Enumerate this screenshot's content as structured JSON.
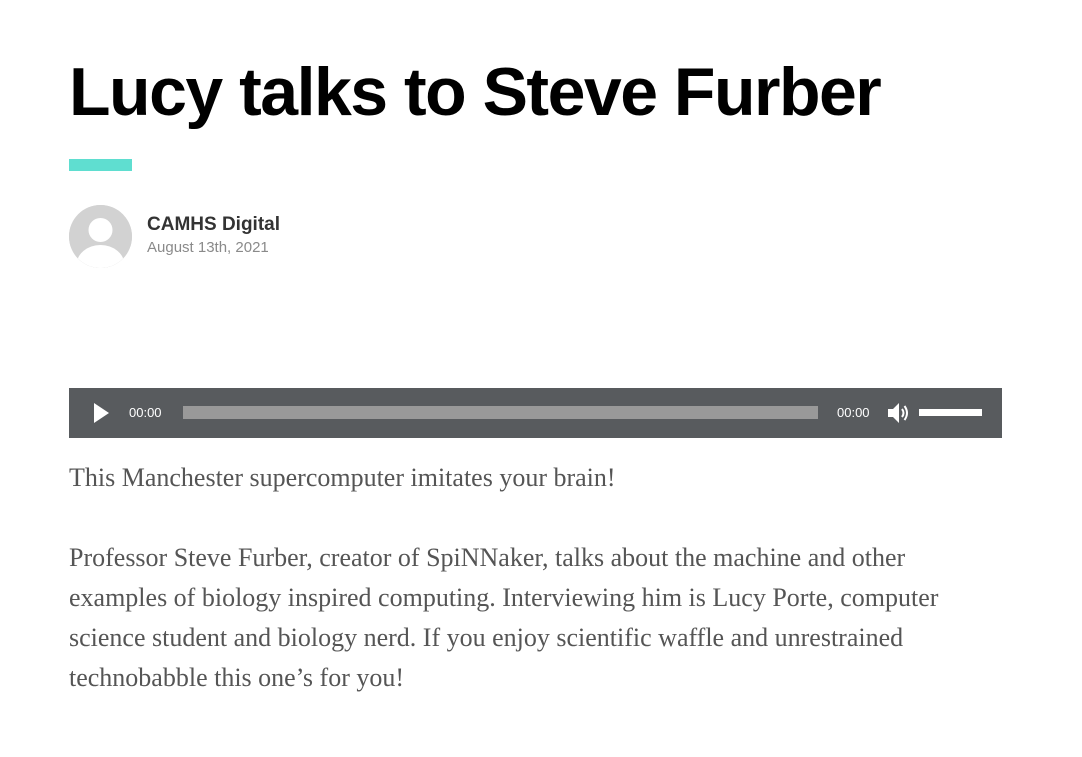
{
  "post": {
    "title": "Lucy talks to Steve Furber",
    "author": "CAMHS Digital",
    "date": "August 13th, 2021"
  },
  "player": {
    "current_time": "00:00",
    "duration": "00:00",
    "progress": 0,
    "volume": 1.0,
    "play_icon": "play-icon",
    "mute_icon": "volume-icon"
  },
  "content": {
    "paragraphs": [
      "This Manchester supercomputer imitates your brain!",
      "Professor Steve Furber, creator of SpiNNaker, talks about the machine and other examples of biology inspired computing. Interviewing him is Lucy Porte, computer science student and biology nerd. If you enjoy scientific waffle and unrestrained technobabble this one’s for you!"
    ]
  },
  "colors": {
    "accent": "#5fded0",
    "player_bg": "#585b5e",
    "title": "#000000",
    "body_text": "#555555"
  }
}
